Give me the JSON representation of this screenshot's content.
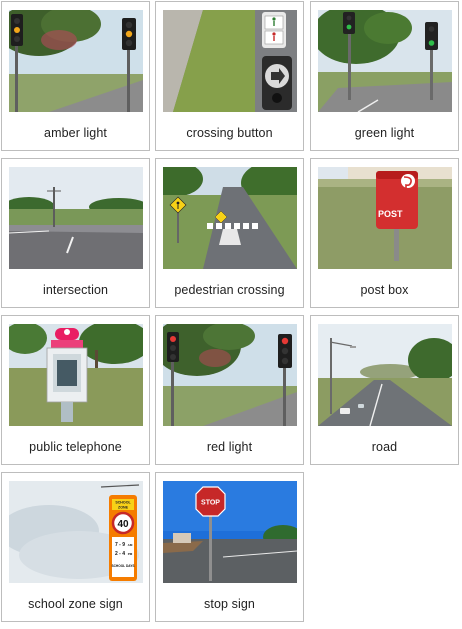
{
  "cards": [
    {
      "label": "amber light"
    },
    {
      "label": "crossing button"
    },
    {
      "label": "green light"
    },
    {
      "label": "intersection"
    },
    {
      "label": "pedestrian crossing"
    },
    {
      "label": "post box"
    },
    {
      "label": "public telephone"
    },
    {
      "label": "red light"
    },
    {
      "label": "road"
    },
    {
      "label": "school zone sign"
    },
    {
      "label": "stop sign"
    }
  ],
  "sign_text": {
    "post": "POST",
    "stop": "STOP",
    "school": "SCHOOL",
    "zone": "ZONE",
    "speed": "40",
    "days": "SCHOOL DAYS",
    "times_top": "7 - 9",
    "times_am": "AM",
    "times_bottom": "2 - 4",
    "times_pm": "PM"
  },
  "colors": {
    "card_border": "#bdbdbd",
    "caption_text": "#222222",
    "post_red": "#d32f2f",
    "stop_red": "#c62828",
    "school_orange": "#f57c00",
    "phone_pink": "#e91e63"
  },
  "icons": {
    "post_logo": "auspost-logo",
    "walk_signal": "pedestrian-walk-icon",
    "arrow": "arrow-right-icon",
    "school_children": "children-crossing-icon"
  }
}
